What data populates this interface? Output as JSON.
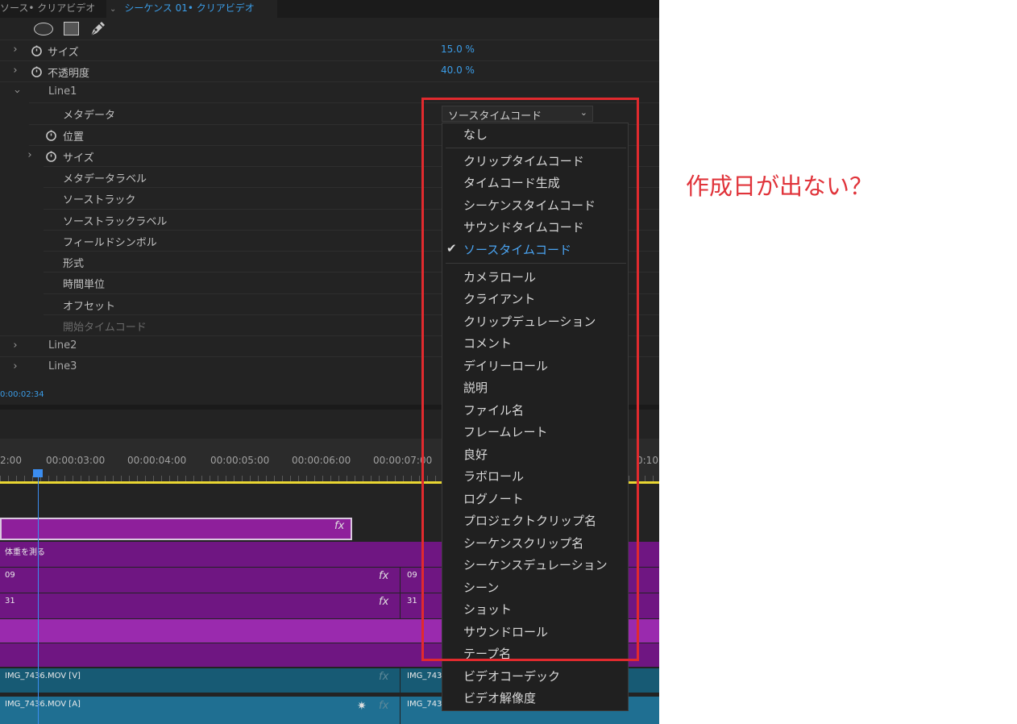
{
  "tabs": {
    "source": "ソース• クリアビデオ",
    "sequence_chevron": "⌄",
    "sequence": "シーケンス 01• クリアビデオ"
  },
  "properties": {
    "size": {
      "label": "サイズ",
      "value": "15.0",
      "unit": "%"
    },
    "opacity": {
      "label": "不透明度",
      "value": "40.0",
      "unit": "%"
    },
    "line1": "Line1",
    "metadata": "メタデータ",
    "position": "位置",
    "size2": "サイズ",
    "metadata_label": "メタデータラベル",
    "source_track": "ソーストラック",
    "source_track_label": "ソーストラックラベル",
    "field_symbol": "フィールドシンボル",
    "format": "形式",
    "time_unit": "時間単位",
    "offset": "オフセット",
    "start_timecode": "開始タイムコード",
    "line2": "Line2",
    "line3": "Line3"
  },
  "timecode_readout": "0:00:02:34",
  "ruler": {
    "labels": [
      "2:00",
      "00:00:03:00",
      "00:00:04:00",
      "00:00:05:00",
      "00:00:06:00",
      "00:00:07:00",
      "0:10"
    ]
  },
  "clips": {
    "graphic_fx": "fx",
    "c2_name": "体重を測る",
    "c3_name": "09",
    "c3b_name": "09",
    "c4_name": "31",
    "c4b_name": "31",
    "v1_name": "IMG_7436.MOV [V]",
    "v1b_name": "IMG_743",
    "a1_name": "IMG_7436.MOV [A]",
    "a1b_name": "IMG_743",
    "fx": "fx",
    "star": "✷"
  },
  "select": {
    "value": "ソースタイムコード",
    "chevron": "⌄"
  },
  "menu": {
    "check": "✔",
    "items": [
      "なし",
      "クリップタイムコード",
      "タイムコード生成",
      "シーケンスタイムコード",
      "サウンドタイムコード",
      "ソースタイムコード",
      "カメラロール",
      "クライアント",
      "クリップデュレーション",
      "コメント",
      "デイリーロール",
      "説明",
      "ファイル名",
      "フレームレート",
      "良好",
      "ラボロール",
      "ログノート",
      "プロジェクトクリップ名",
      "シーケンスクリップ名",
      "シーケンスデュレーション",
      "シーン",
      "ショット",
      "サウンドロール",
      "テープ名",
      "ビデオコーデック",
      "ビデオ解像度"
    ],
    "selected": "ソースタイムコード"
  },
  "annotation": "作成日が出ない？",
  "colors": {
    "accent_blue": "#3b9ce6",
    "annotation_red": "#e12a2e",
    "clip_purple": "#7a1a8a",
    "clip_teal": "#175a74",
    "timeline_yellow": "#e9d632"
  }
}
